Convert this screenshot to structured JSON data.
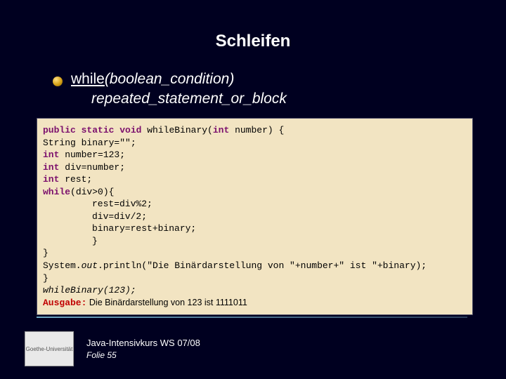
{
  "title": "Schleifen",
  "syntax": {
    "keyword": "while",
    "args": "(boolean_condition)",
    "line2": "repeated_statement_or_block"
  },
  "code": {
    "l1a": "public static void ",
    "l1b": "whileBinary(",
    "l1c": "int",
    "l1d": " number) {",
    "l2": "String binary=\"\";",
    "l3a": "int",
    "l3b": " number=123;",
    "l4a": "int",
    "l4b": " div=number;",
    "l5a": "int",
    "l5b": " rest;",
    "l6a": "while",
    "l6b": "(div>0){",
    "l7": "rest=div%2;",
    "l8": "div=div/2;",
    "l9": "binary=rest+binary;",
    "l10": "}",
    "l11": "}",
    "l12a": "System.",
    "l12b": "out",
    "l12c": ".println(\"Die Binärdarstellung von \"+number+\" ist \"+binary);",
    "l13": "}",
    "l14": "whileBinary(123);",
    "outLabel": "Ausgabe:",
    "outText": "  Die Binärdarstellung von 123 ist 1111011"
  },
  "footer": {
    "line1": "Java-Intensivkurs WS 07/08",
    "line2": "Folie 55",
    "logo": "Goethe-Universität"
  }
}
